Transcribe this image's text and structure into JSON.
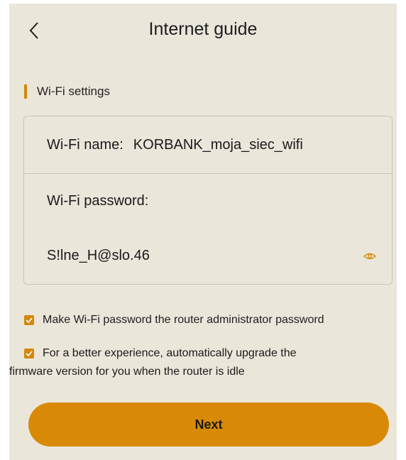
{
  "header": {
    "title": "Internet guide"
  },
  "section": {
    "title": "Wi-Fi settings"
  },
  "wifi": {
    "name_label": "Wi-Fi name:",
    "name_value": "KORBANK_moja_siec_wifi",
    "password_label": "Wi-Fi password:",
    "password_value": "S!lne_H@slo.46"
  },
  "options": {
    "admin_password": {
      "label": "Make Wi-Fi password the router administrator password",
      "checked": true
    },
    "auto_upgrade": {
      "label_line1": "For a better experience, automatically upgrade the",
      "label_line2": "firmware version for you when the router is idle",
      "checked": true
    }
  },
  "actions": {
    "next_label": "Next"
  },
  "colors": {
    "accent": "#d88a07",
    "background": "#ebe6da",
    "border": "#c9c4b9"
  },
  "icons": {
    "back": "chevron-left-icon",
    "eye": "eye-icon",
    "check": "check-icon"
  }
}
